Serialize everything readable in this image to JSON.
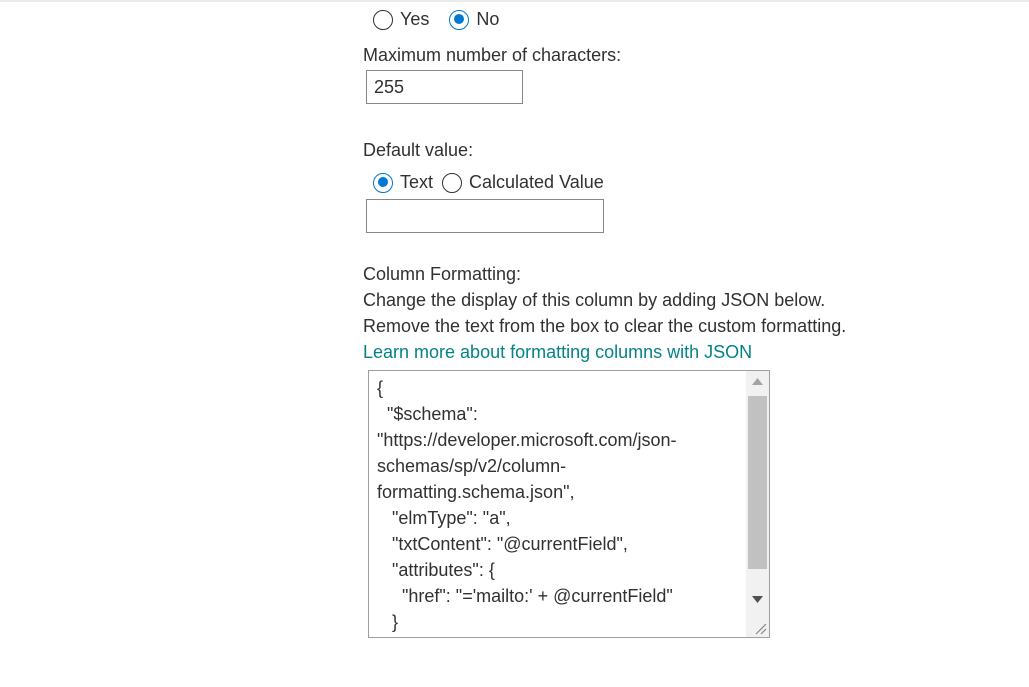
{
  "required": {
    "options": [
      {
        "label": "Yes",
        "checked": false
      },
      {
        "label": "No",
        "checked": true
      }
    ]
  },
  "max_chars": {
    "label": "Maximum number of characters:",
    "value": "255"
  },
  "default_value": {
    "label": "Default value:",
    "options": [
      {
        "label": "Text",
        "checked": true
      },
      {
        "label": "Calculated Value",
        "checked": false
      }
    ],
    "value": ""
  },
  "column_formatting": {
    "title": "Column Formatting:",
    "line1": "Change the display of this column by adding JSON below.",
    "line2": "Remove the text from the box to clear the custom formatting.",
    "link": "Learn more about formatting columns with JSON",
    "json_lines": [
      "{",
      "  \"$schema\":",
      "\"https://developer.microsoft.com/json-",
      "schemas/sp/v2/column-",
      "formatting.schema.json\",",
      "   \"elmType\": \"a\",",
      "   \"txtContent\": \"@currentField\",",
      "   \"attributes\": {",
      "     \"href\": \"='mailto:' + @currentField\"",
      "   }"
    ]
  },
  "colors": {
    "accent": "#0078d4",
    "link": "#038387",
    "text": "#323130"
  }
}
